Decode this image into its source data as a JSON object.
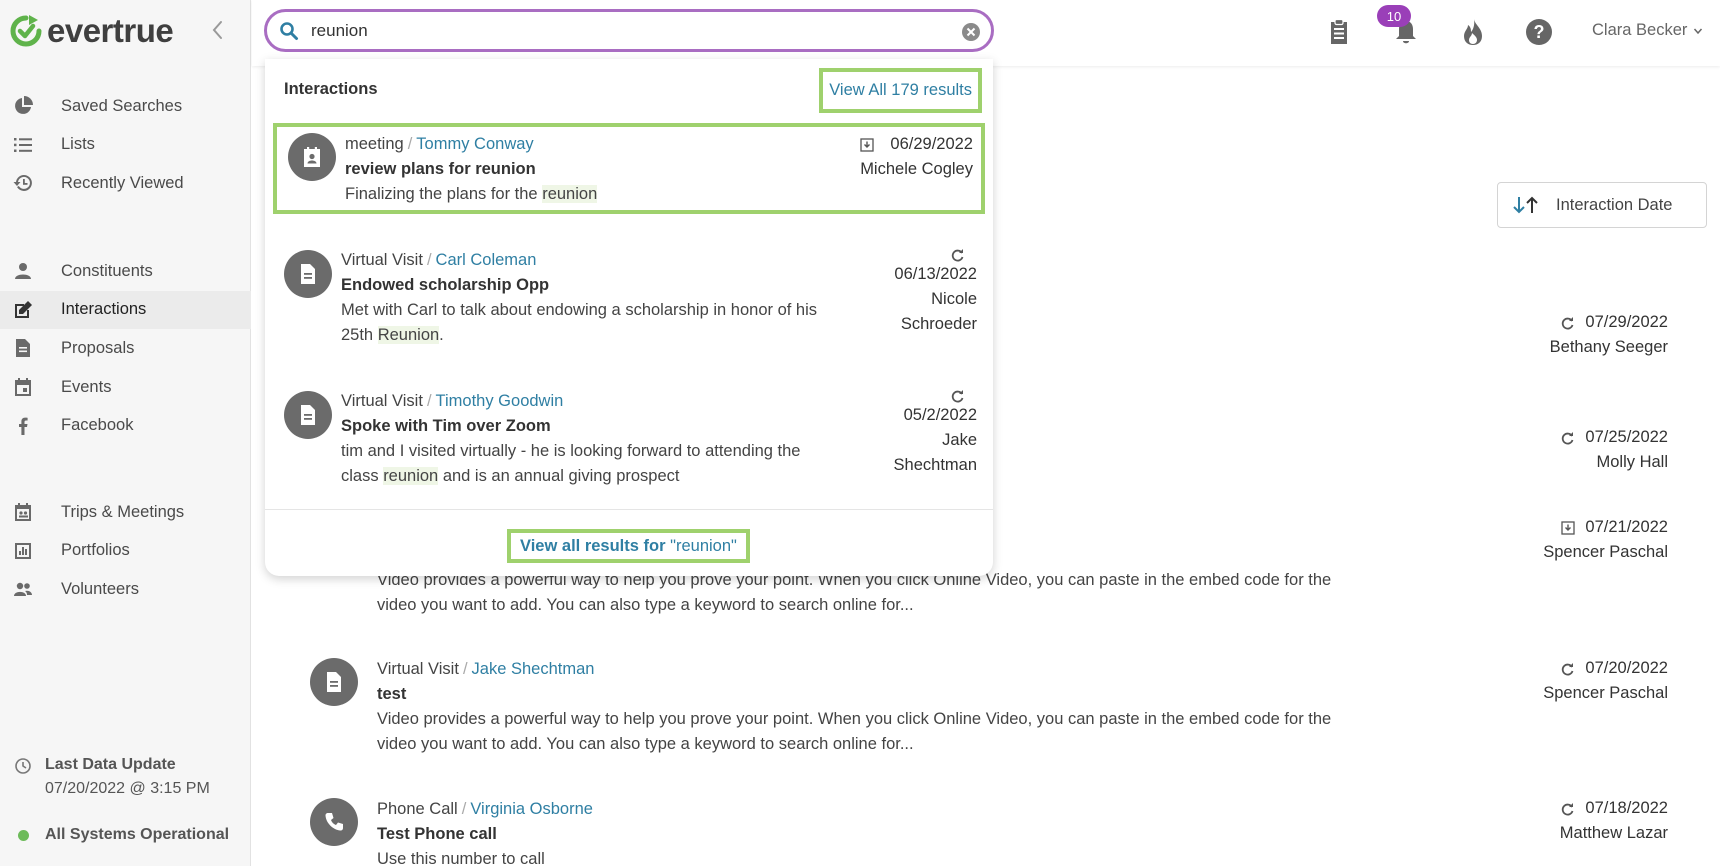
{
  "app": {
    "brand": "evertrue"
  },
  "sidebar": {
    "group1": [
      {
        "label": "Saved Searches",
        "icon": "pie-chart-icon"
      },
      {
        "label": "Lists",
        "icon": "list-icon"
      },
      {
        "label": "Recently Viewed",
        "icon": "history-icon"
      }
    ],
    "group2": [
      {
        "label": "Constituents",
        "icon": "person-icon"
      },
      {
        "label": "Interactions",
        "icon": "edit-icon",
        "active": true
      },
      {
        "label": "Proposals",
        "icon": "document-icon"
      },
      {
        "label": "Events",
        "icon": "calendar-icon"
      },
      {
        "label": "Facebook",
        "icon": "facebook-icon"
      }
    ],
    "group3": [
      {
        "label": "Trips & Meetings",
        "icon": "calendar-people-icon"
      },
      {
        "label": "Portfolios",
        "icon": "bar-chart-icon"
      },
      {
        "label": "Volunteers",
        "icon": "people-icon"
      }
    ],
    "status": {
      "title": "Last Data Update",
      "timestamp": "07/20/2022 @ 3:15 PM",
      "system": "All Systems Operational"
    }
  },
  "header": {
    "search_value": "reunion",
    "notification_count": "10",
    "user_name": "Clara Becker"
  },
  "sort": {
    "label": "Interaction Date"
  },
  "dropdown": {
    "section_title": "Interactions",
    "view_all_label": "View All 179 results",
    "items": [
      {
        "type": "meeting",
        "contact": "Tommy Conway",
        "subject": "review plans for reunion",
        "body_pre": "Finalizing the plans for the ",
        "body_hl": "reunion",
        "body_post": "",
        "date": "06/29/2022",
        "owner": "Michele Cogley",
        "icon": "meeting-badge-icon"
      },
      {
        "type": "Virtual Visit",
        "contact": "Carl Coleman",
        "subject": "Endowed scholarship Opp",
        "body_pre": "Met with Carl to talk about endowing a scholarship in honor of his 25th ",
        "body_hl": "Reunion",
        "body_post": ".",
        "date": "06/13/2022",
        "owner_1": "Nicole",
        "owner_2": "Schroeder",
        "icon": "document-icon"
      },
      {
        "type": "Virtual Visit",
        "contact": "Timothy Goodwin",
        "subject": "Spoke with Tim over Zoom",
        "body_pre": "tim and I visited virtually - he is looking forward to attending the class ",
        "body_hl": "reunion",
        "body_post": " and is an annual giving prospect",
        "date": "05/2/2022",
        "owner_1": "Jake",
        "owner_2": "Shechtman",
        "icon": "document-icon"
      }
    ],
    "footer_label": "View all results for",
    "footer_query": "\"reunion\""
  },
  "list": {
    "meta_rows": [
      {
        "date": "07/29/2022",
        "owner": "Bethany Seeger"
      },
      {
        "date": "07/25/2022",
        "owner": "Molly Hall"
      },
      {
        "date": "07/21/2022",
        "owner": "Spencer Paschal"
      }
    ],
    "partial_body": "Video provides a powerful way to help you prove your point. When you click Online Video, you can paste in the embed code for the video you want to add. You can also type a keyword to search online for...",
    "rows": [
      {
        "type": "Virtual Visit",
        "contact": "Jake Shechtman",
        "subject": "test",
        "body": "Video provides a powerful way to help you prove your point. When you click Online Video, you can paste in the embed code for the video you want to add. You can also type a keyword to search online for...",
        "date": "07/20/2022",
        "owner": "Spencer Paschal"
      },
      {
        "type": "Phone Call",
        "contact": "Virginia Osborne",
        "subject": "Test Phone call",
        "body": "Use this number to call",
        "date": "07/18/2022",
        "owner": "Matthew Lazar"
      }
    ]
  },
  "colors": {
    "accent_purple": "#a96dc2",
    "link_blue": "#2f7fa3",
    "highlight_green": "#9fd16d",
    "badge_purple": "#9a3fb8",
    "logo_green": "#5fb34b"
  }
}
